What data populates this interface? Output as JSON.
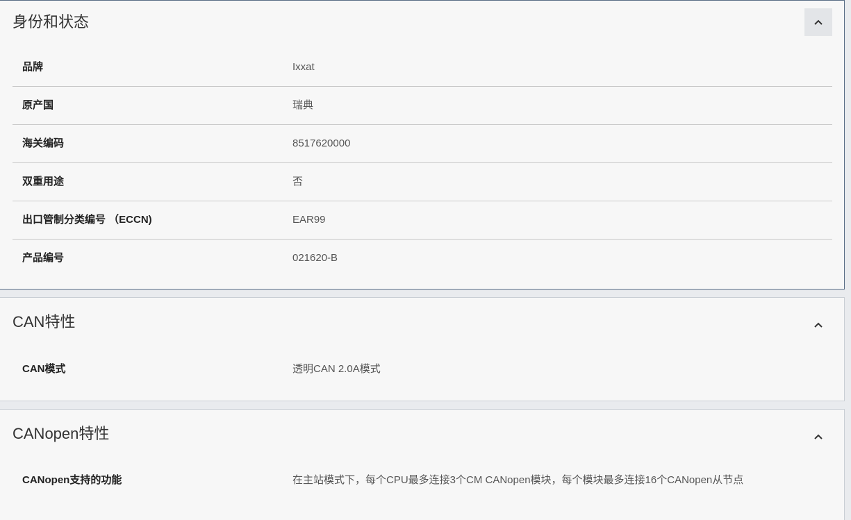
{
  "sections": [
    {
      "title": "身份和状态",
      "rows": [
        {
          "label": "品牌",
          "value": "Ixxat"
        },
        {
          "label": "原产国",
          "value": "瑞典"
        },
        {
          "label": "海关编码",
          "value": "8517620000"
        },
        {
          "label": "双重用途",
          "value": "否"
        },
        {
          "label": "出口管制分类编号 （ECCN)",
          "value": "EAR99"
        },
        {
          "label": "产品编号",
          "value": "021620-B"
        }
      ]
    },
    {
      "title": "CAN特性",
      "rows": [
        {
          "label": "CAN模式",
          "value": "透明CAN 2.0A模式"
        }
      ]
    },
    {
      "title": "CANopen特性",
      "rows": [
        {
          "label": "CANopen支持的功能",
          "value": "在主站模式下，每个CPU最多连接3个CM CANopen模块，每个模块最多连接16个CANopen从节点"
        }
      ]
    }
  ],
  "icons": {
    "collapse": "chevron-up-icon"
  },
  "colors": {
    "active_border": "#5a6e86",
    "panel_bg": "#f7f7f7",
    "page_bg": "#e9ebee"
  }
}
